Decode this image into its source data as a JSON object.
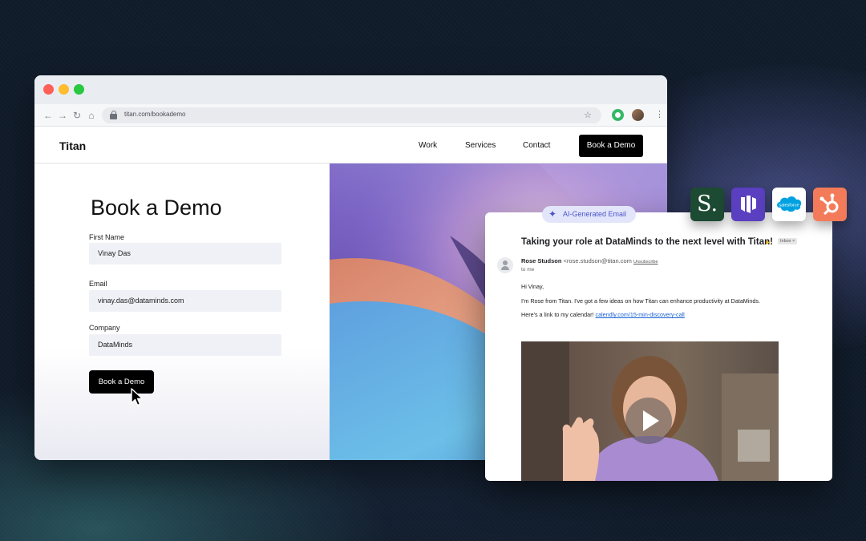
{
  "browser": {
    "url": "titan.com/bookademo",
    "nav_icons": [
      "back-icon",
      "forward-icon",
      "reload-icon",
      "home-icon"
    ]
  },
  "site": {
    "logo": "Titan",
    "nav": [
      "Work",
      "Services",
      "Contact"
    ],
    "cta": "Book a Demo"
  },
  "form": {
    "title": "Book a Demo",
    "fields": [
      {
        "label": "First Name",
        "value": "Vinay Das"
      },
      {
        "label": "Email",
        "value": "vinay.das@dataminds.com"
      },
      {
        "label": "Company",
        "value": "DataMinds"
      }
    ],
    "submit": "Book a Demo"
  },
  "email": {
    "badge": "AI-Generated Email",
    "subject": "Taking your role at DataMinds to the next level with Titan!",
    "inbox_tag": "Inbox ×",
    "sender_name": "Rose Studson",
    "sender_email": "<rose.studson@titan.com",
    "unsubscribe": "Unsubscribe",
    "to": "to me",
    "greeting": "Hi Vinay,",
    "body": "I'm Rose from Titan. I've got a few ideas on how Titan can enhance productivity at DataMinds.",
    "link_intro": "Here's a link to my calendar!",
    "link": "calendly.com/15-min-discovery-call"
  },
  "integrations": [
    "Salesloft",
    "Outreach",
    "salesforce",
    "HubSpot"
  ],
  "integration_labels": {
    "salesforce": "salesforce",
    "salesloft": "S."
  },
  "colors": {
    "accent": "#4a55c8",
    "salesloft": "#1d4a33",
    "outreach": "#5a3fc0",
    "salesforce": "#00a1e0",
    "hubspot": "#f47b5a"
  }
}
